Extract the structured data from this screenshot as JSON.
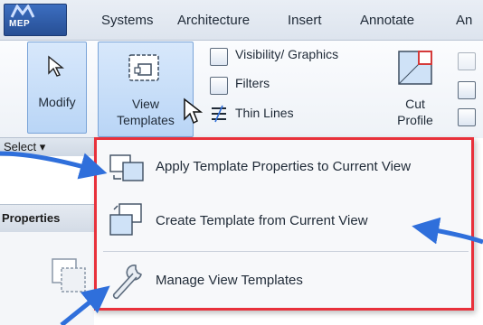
{
  "app": {
    "mode_badge": "MEP"
  },
  "tabs": [
    "Systems",
    "Architecture",
    "Insert",
    "Annotate",
    "An"
  ],
  "ribbon": {
    "modify_label": "Modify",
    "view_templates_label_line1": "View",
    "view_templates_label_line2": "Templates",
    "visibility_graphics_label": "Visibility/ Graphics",
    "filters_label": "Filters",
    "thin_lines_label": "Thin  Lines",
    "cut_profile_label_line1": "Cut",
    "cut_profile_label_line2": "Profile",
    "select_label": "Select ▾"
  },
  "properties": {
    "title": "Properties"
  },
  "menu": {
    "items": [
      {
        "label": "Apply Template Properties to Current View",
        "icon": "apply-template-icon"
      },
      {
        "label": "Create Template from Current View",
        "icon": "create-template-icon"
      },
      {
        "label": "Manage View Templates",
        "icon": "wrench-icon"
      }
    ]
  },
  "colors": {
    "highlight_box": "#e8313b",
    "callout_arrow": "#2f6fdb",
    "ribbon_selected": "#b9d5f6",
    "mode_badge": "#2f5ea8"
  }
}
